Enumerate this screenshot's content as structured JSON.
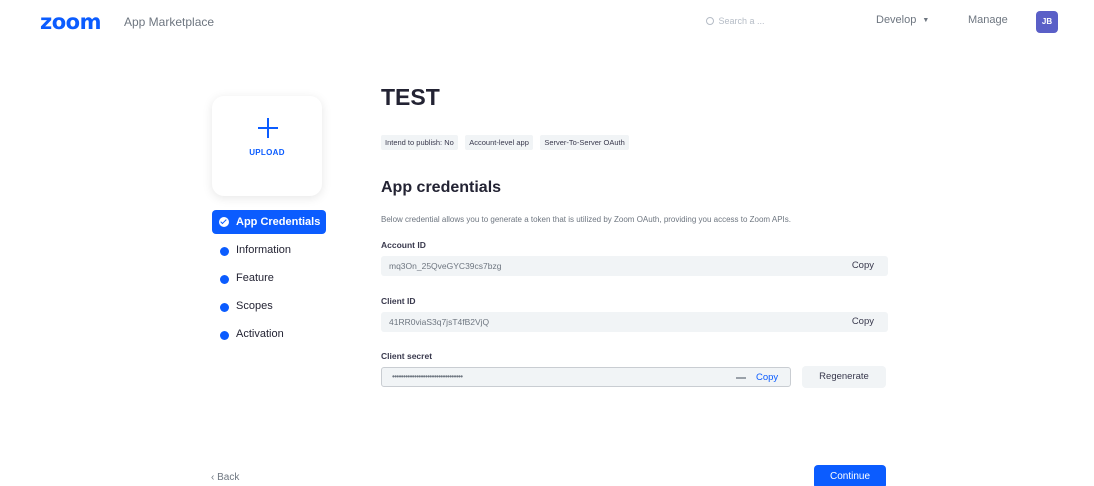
{
  "header": {
    "logo": "zoom",
    "app_name": "App Marketplace",
    "search_placeholder": "Search a ...",
    "develop_label": "Develop",
    "manage_label": "Manage",
    "avatar_initials": "JB"
  },
  "upload": {
    "label": "UPLOAD"
  },
  "sidebar": {
    "items": [
      {
        "label": "App Credentials",
        "active": true
      },
      {
        "label": "Information"
      },
      {
        "label": "Feature"
      },
      {
        "label": "Scopes"
      },
      {
        "label": "Activation"
      }
    ]
  },
  "main": {
    "title": "TEST",
    "tags": [
      "Intend to publish: No",
      "Account-level app",
      "Server-To-Server OAuth"
    ],
    "section_title": "App credentials",
    "section_desc": "Below credential allows you to generate a token that is utilized by Zoom OAuth, providing you access to Zoom APIs.",
    "fields": [
      {
        "label": "Account ID",
        "value": "mq3On_25QveGYC39cs7bzg",
        "copy_label": "Copy"
      },
      {
        "label": "Client ID",
        "value": "41RR0viaS3q7jsT4fB2VjQ",
        "copy_label": "Copy"
      }
    ],
    "secret": {
      "label": "Client secret",
      "value": "••••••••••••••••••••••••••••••••",
      "copy_label": "Copy",
      "regenerate_label": "Regenerate"
    }
  },
  "footer": {
    "back_label": "Back",
    "continue_label": "Continue"
  },
  "colors": {
    "brand": "#0b5cff",
    "field_bg": "#f1f4f6",
    "text_primary": "#232333",
    "text_muted": "#6e7680"
  }
}
